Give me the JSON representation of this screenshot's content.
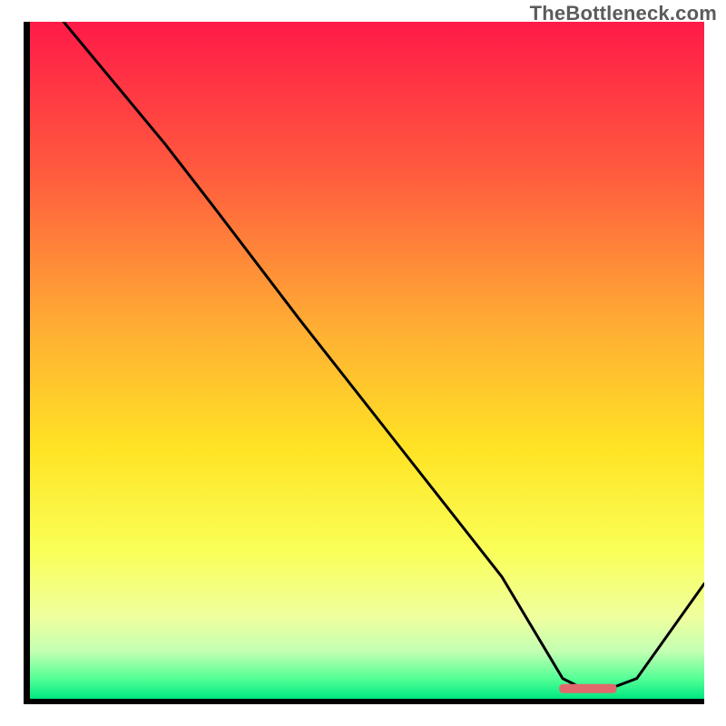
{
  "watermark": "TheBottleneck.com",
  "chart_data": {
    "type": "line",
    "title": "",
    "xlabel": "",
    "ylabel": "",
    "xlim": [
      0,
      100
    ],
    "ylim": [
      0,
      100
    ],
    "background": {
      "type": "vertical-gradient",
      "stops": [
        {
          "pct": 0,
          "color": "#ff1a48"
        },
        {
          "pct": 22,
          "color": "#ff5a3e"
        },
        {
          "pct": 45,
          "color": "#ffad34"
        },
        {
          "pct": 63,
          "color": "#ffe324"
        },
        {
          "pct": 78,
          "color": "#faff57"
        },
        {
          "pct": 88,
          "color": "#efff9f"
        },
        {
          "pct": 93,
          "color": "#c3ffb2"
        },
        {
          "pct": 97,
          "color": "#55ff96"
        },
        {
          "pct": 100,
          "color": "#00e882"
        }
      ]
    },
    "x": [
      0,
      5,
      20,
      27,
      40,
      55,
      70,
      76,
      79,
      82,
      86,
      90,
      100
    ],
    "values": [
      108,
      100,
      82,
      73,
      56,
      37,
      18,
      8,
      3,
      1.5,
      1.5,
      3,
      17
    ],
    "optimum_marker": {
      "x_start": 78.5,
      "x_end": 87,
      "y": 1.5,
      "color": "#e0696b"
    }
  }
}
